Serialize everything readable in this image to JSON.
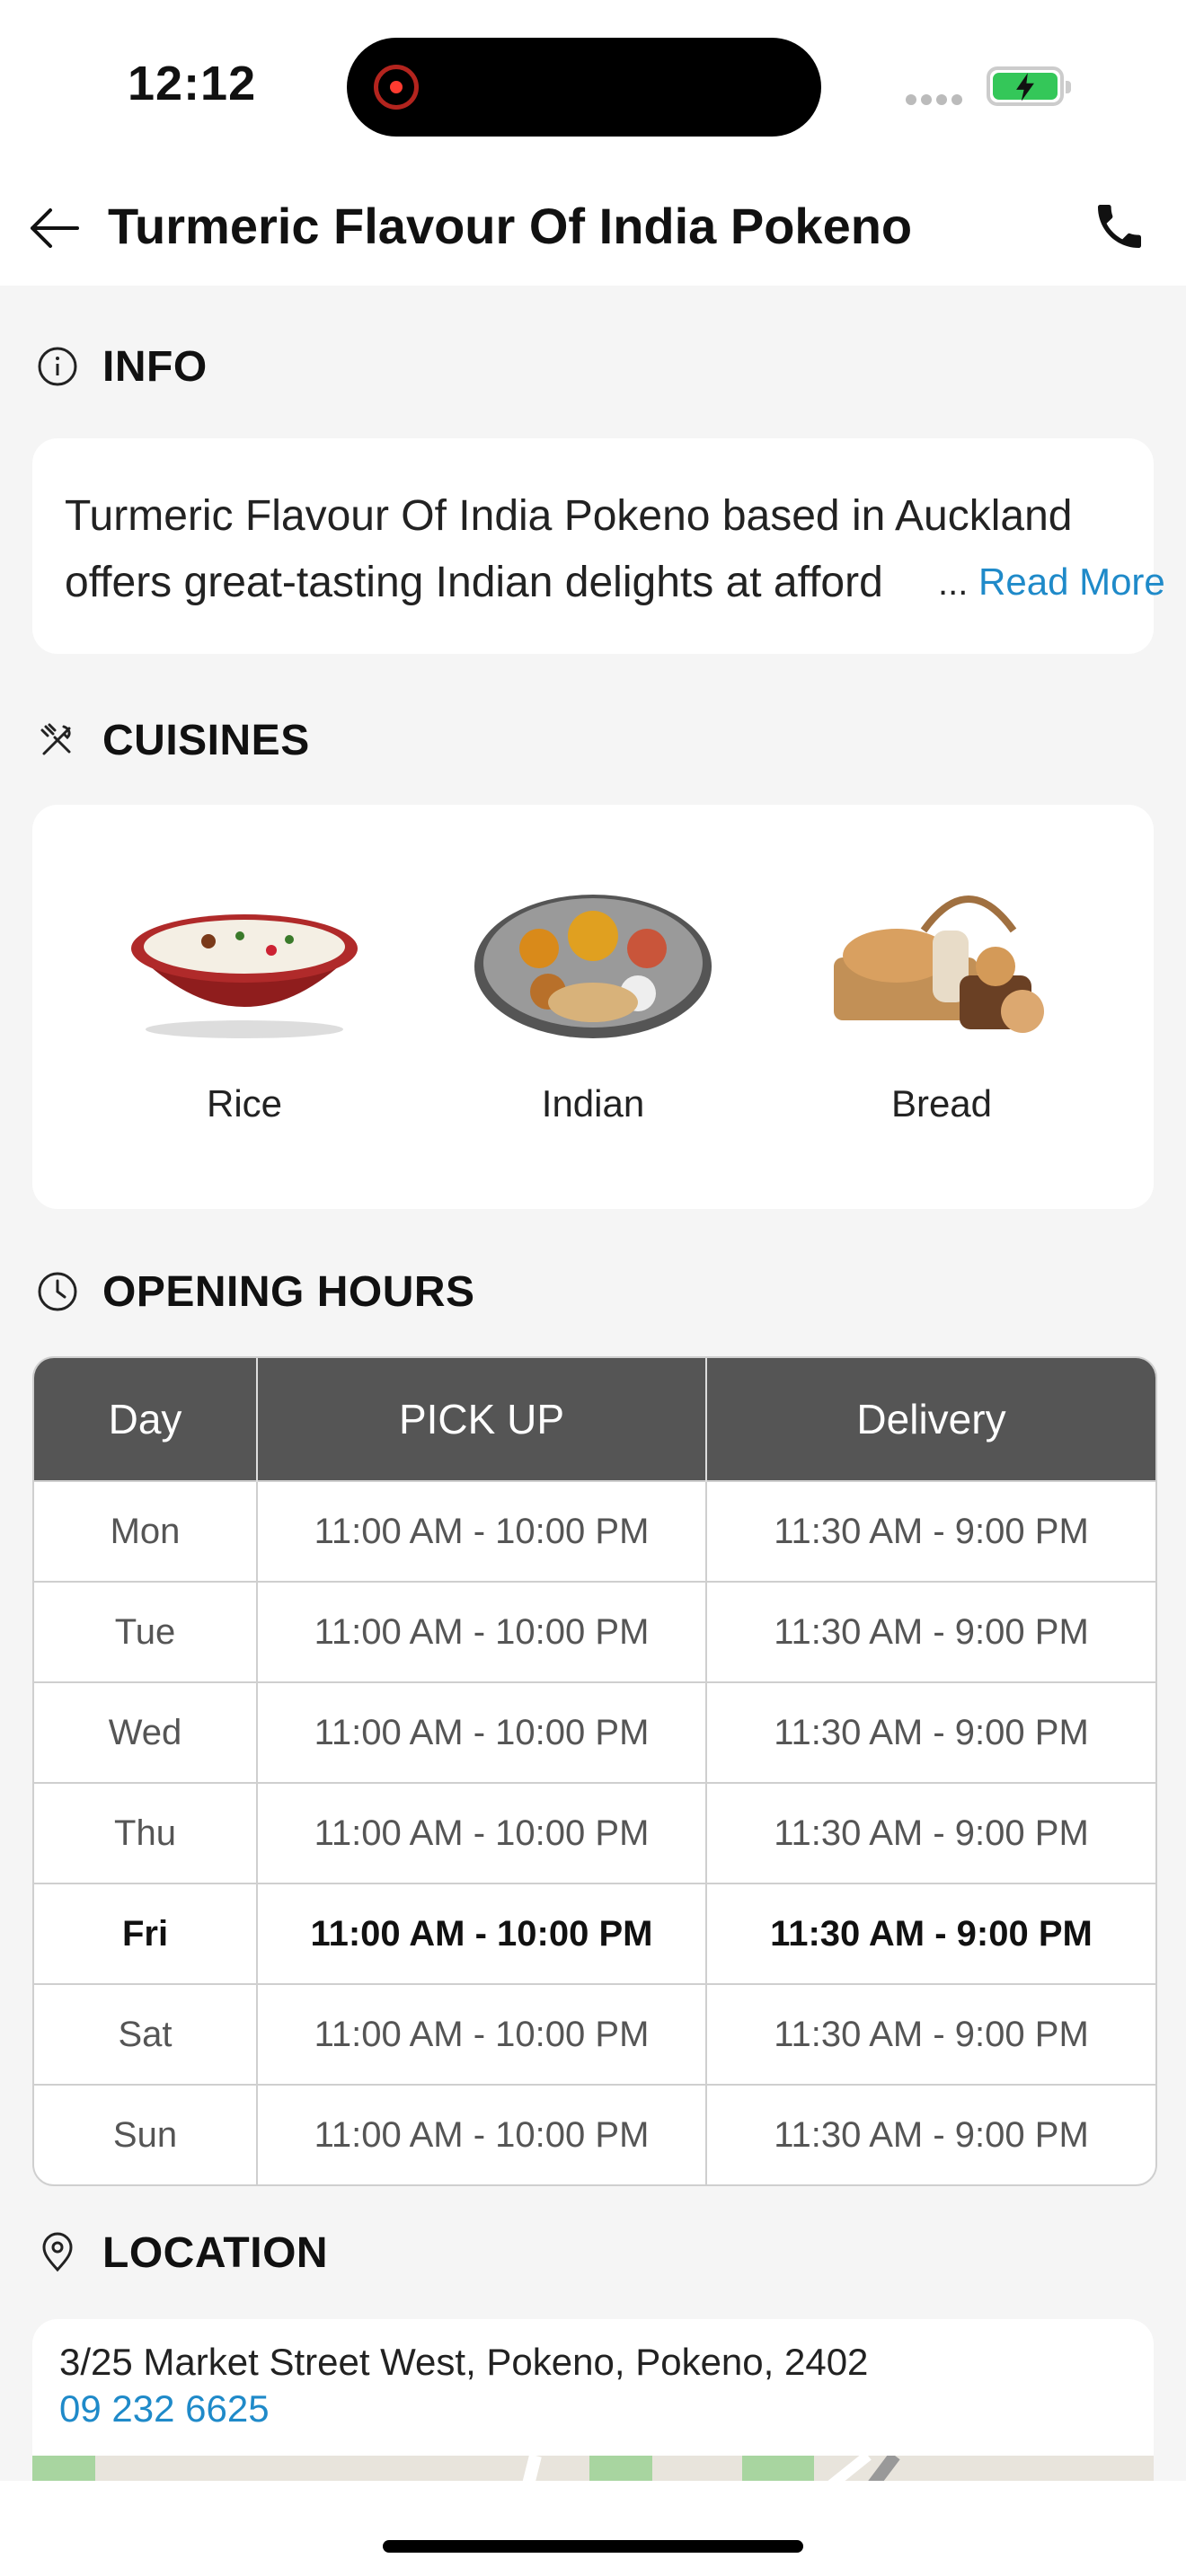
{
  "status": {
    "time": "12:12"
  },
  "header": {
    "title": "Turmeric Flavour Of India Pokeno",
    "back_icon": "arrow-left-icon",
    "call_icon": "phone-icon"
  },
  "info": {
    "heading": "INFO",
    "text": "Turmeric Flavour Of India Pokeno based in Auckland offers great-tasting Indian delights at afford",
    "ellipsis": "...",
    "read_more": "Read More"
  },
  "cuisines": {
    "heading": "CUISINES",
    "items": [
      {
        "label": "Rice"
      },
      {
        "label": "Indian"
      },
      {
        "label": "Bread"
      }
    ]
  },
  "opening_hours": {
    "heading": "OPENING HOURS",
    "columns": [
      "Day",
      "PICK UP",
      "Delivery"
    ],
    "rows": [
      {
        "day": "Mon",
        "pickup": "11:00 AM - 10:00 PM",
        "delivery": "11:30 AM - 9:00 PM"
      },
      {
        "day": "Tue",
        "pickup": "11:00 AM - 10:00 PM",
        "delivery": "11:30 AM - 9:00 PM"
      },
      {
        "day": "Wed",
        "pickup": "11:00 AM - 10:00 PM",
        "delivery": "11:30 AM - 9:00 PM"
      },
      {
        "day": "Thu",
        "pickup": "11:00 AM - 10:00 PM",
        "delivery": "11:30 AM - 9:00 PM"
      },
      {
        "day": "Fri",
        "pickup": "11:00 AM - 10:00 PM",
        "delivery": "11:30 AM - 9:00 PM"
      },
      {
        "day": "Sat",
        "pickup": "11:00 AM - 10:00 PM",
        "delivery": "11:30 AM - 9:00 PM"
      },
      {
        "day": "Sun",
        "pickup": "11:00 AM - 10:00 PM",
        "delivery": "11:30 AM - 9:00 PM"
      }
    ],
    "highlighted_day": "Fri"
  },
  "location": {
    "heading": "LOCATION",
    "address": "3/25 Market Street West, Pokeno, Pokeno, 2402",
    "phone": "09 232 6625"
  },
  "colors": {
    "accent": "#1f8ac9",
    "table_header": "#555555",
    "battery": "#34c759"
  }
}
